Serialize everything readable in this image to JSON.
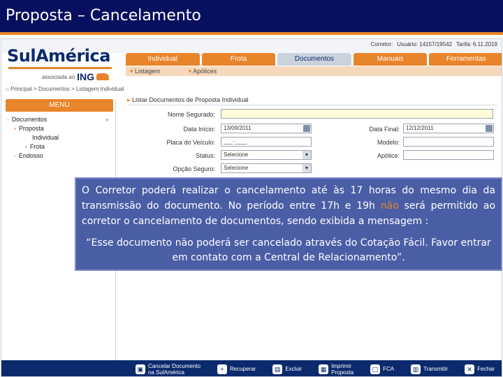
{
  "slide": {
    "title": "Proposta – Cancelamento"
  },
  "app": {
    "brand": "SulAmérica",
    "brand_sub": "associada ao",
    "brand_partner": "ING",
    "top_info": [
      "Corretor:",
      "Usuário: 14157/19542",
      "Tarifa: 6.11.2019"
    ]
  },
  "nav": {
    "tabs": [
      "Individual",
      "Frota",
      "Documentos",
      "Manuais",
      "Ferramentas"
    ],
    "active": "Documentos",
    "subnav": [
      "Listagem",
      "Apólices"
    ]
  },
  "breadcrumb": "Principal > Documentos > Listagem Individual",
  "sidebar": {
    "menu": "MENU",
    "items": [
      "Documentos",
      "Proposta",
      "Individual",
      "Frota",
      "Endosso"
    ]
  },
  "form": {
    "title": "Listar Documentos de Proposta Individual",
    "labels": {
      "nome": "Nome Segurado:",
      "data_inicio": "Data Início:",
      "data_final": "Data Final:",
      "placa": "Placa do Veículo:",
      "modelo": "Modelo:",
      "status": "Status:",
      "apolice": "Apólice:",
      "opcao": "Opção Seguro:"
    },
    "values": {
      "nome": "",
      "data_inicio": "13/09/2011",
      "data_final": "12/12/2011",
      "placa": "___-____",
      "modelo": "",
      "status": "Selecione",
      "apolice": "",
      "opcao": "Selecione"
    }
  },
  "toolbar": {
    "buttons": [
      {
        "label1": "Cancelar Documento",
        "label2": "na SulAmérica",
        "icon": "cancel-document-icon"
      },
      {
        "label1": "Recuperar",
        "label2": "",
        "icon": "recover-icon"
      },
      {
        "label1": "Excluir",
        "label2": "",
        "icon": "delete-icon"
      },
      {
        "label1": "Imprimir",
        "label2": "Proposta",
        "icon": "print-icon"
      },
      {
        "label1": "FCA",
        "label2": "",
        "icon": "fca-icon"
      },
      {
        "label1": "Transmitir",
        "label2": "",
        "icon": "transmit-icon"
      },
      {
        "label1": "Fechar",
        "label2": "",
        "icon": "close-icon"
      }
    ]
  },
  "callout": {
    "para_a": "O Corretor poderá realizar o cancelamento até às 17 horas do mesmo dia da transmissão do documento. No período entre 17h e 19h ",
    "para_hl": "não",
    "para_b": " será permitido ao corretor o cancelamento de documentos, sendo exibida a mensagem :",
    "quote": "“Esse documento não poderá ser cancelado através do Cotação Fácil. Favor entrar em contato com a Central de Relacionamento”."
  },
  "colors": {
    "header_bg": "#07105e",
    "accent": "#e8842a",
    "brand_blue": "#0b2a6e",
    "callout_bg": "#4a5ea6",
    "highlight": "#e8842a"
  }
}
